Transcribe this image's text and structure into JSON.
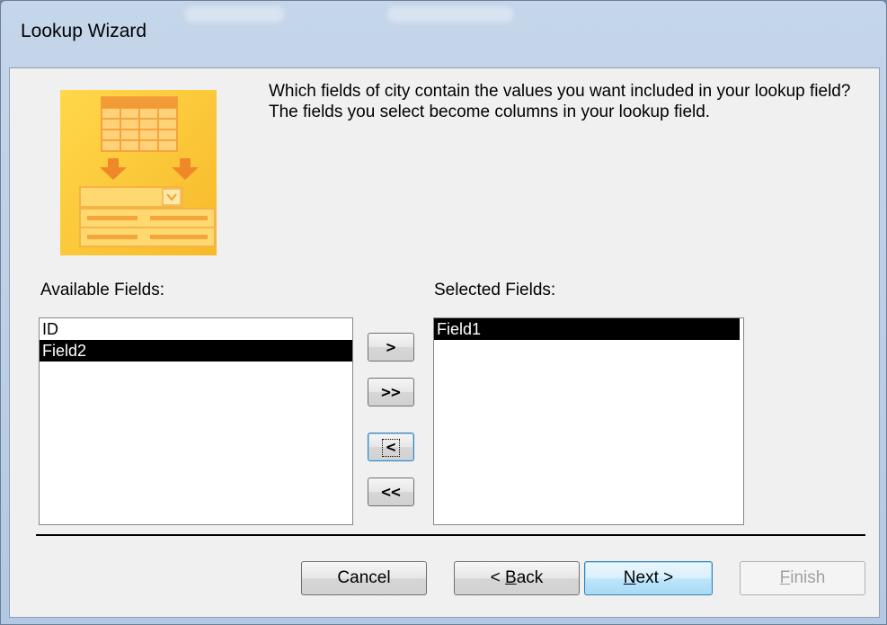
{
  "window": {
    "title": "Lookup Wizard"
  },
  "question": "Which fields of city contain the values you want included in your lookup field? The fields you select become columns in your lookup field.",
  "available": {
    "label": "Available Fields:",
    "items": [
      "ID",
      "Field2"
    ],
    "selected_index": 1
  },
  "selected": {
    "label": "Selected Fields:",
    "items": [
      "Field1"
    ],
    "selected_index": 0
  },
  "move_buttons": {
    "add": ">",
    "add_all": ">>",
    "remove": "<",
    "remove_all": "<<"
  },
  "footer": {
    "cancel": "Cancel",
    "back_prefix": "< ",
    "back_accel": "B",
    "back_rest": "ack",
    "next_accel": "N",
    "next_rest": "ext >",
    "finish_accel": "F",
    "finish_rest": "inish"
  },
  "colors": {
    "wizard_image_accent": "#f9c431",
    "selection": "#000000"
  }
}
